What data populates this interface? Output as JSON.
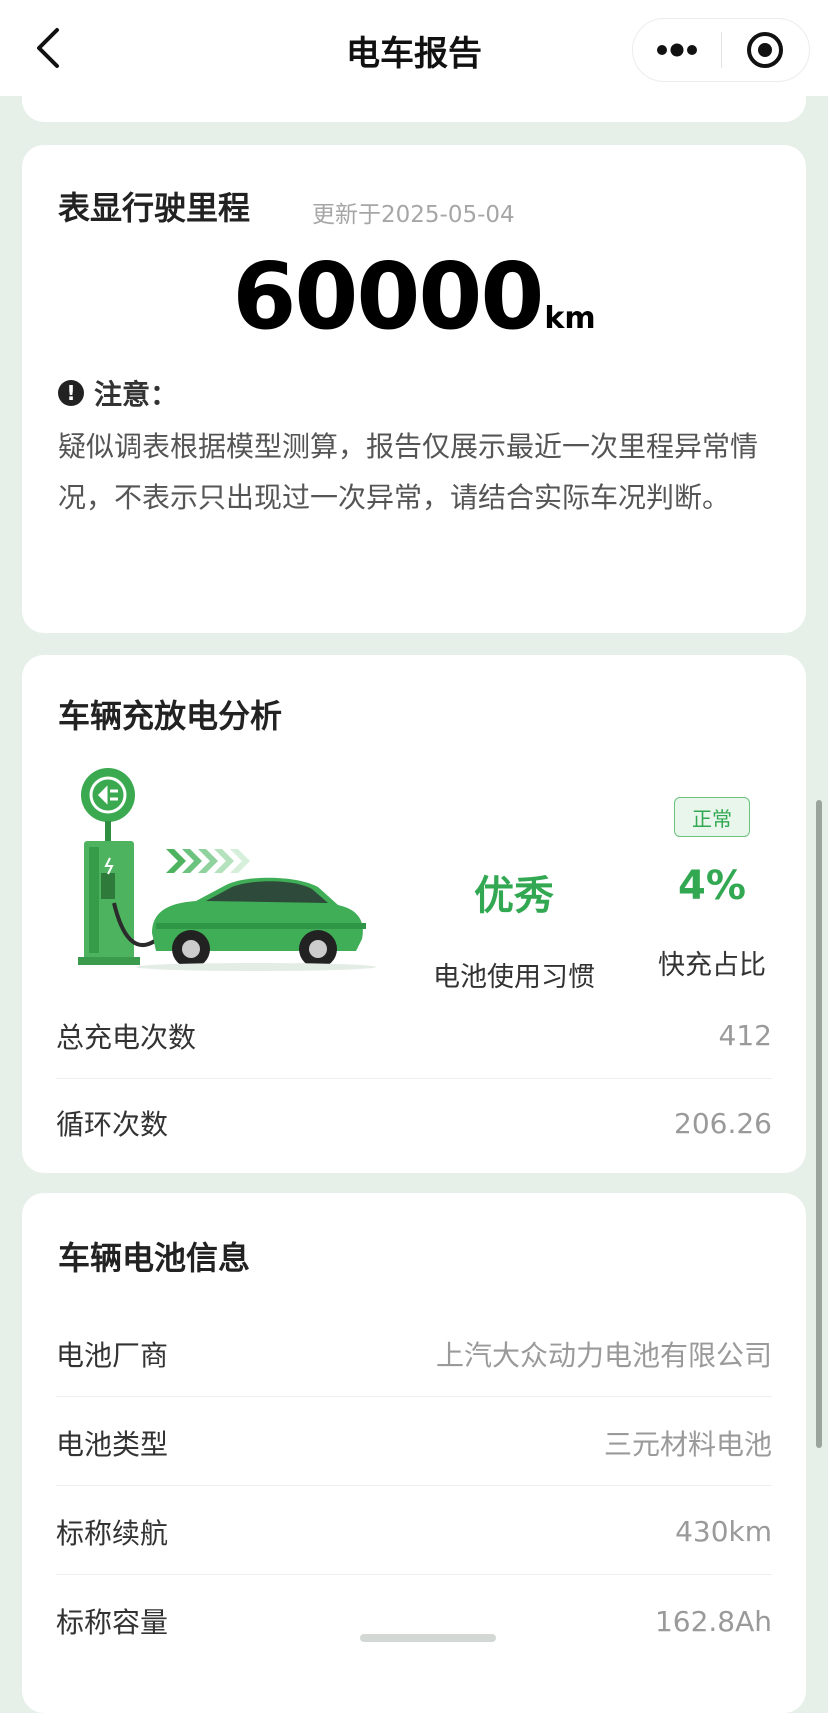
{
  "navbar": {
    "title": "电车报告"
  },
  "mileage_card": {
    "title": "表显行驶里程",
    "updated": "更新于2025-05-04",
    "value": "60000",
    "unit": "km",
    "notice_title": "注意：",
    "notice_icon": "!",
    "notice_text": "疑似调表根据模型测算，报告仅展示最近一次里程异常情况，不表示只出现过一次异常，请结合实际车况判断。"
  },
  "charge_card": {
    "title": "车辆充放电分析",
    "habit_value": "优秀",
    "habit_label": "电池使用习惯",
    "fast_charge_badge": "正常",
    "fast_charge_value": "4%",
    "fast_charge_label": "快充占比",
    "rows": [
      {
        "label": "总充电次数",
        "value": "412"
      },
      {
        "label": "循环次数",
        "value": "206.26"
      }
    ]
  },
  "battery_card": {
    "title": "车辆电池信息",
    "rows": [
      {
        "label": "电池厂商",
        "value": "上汽大众动力电池有限公司"
      },
      {
        "label": "电池类型",
        "value": "三元材料电池"
      },
      {
        "label": "标称续航",
        "value": "430km"
      },
      {
        "label": "标称容量",
        "value": "162.8Ah"
      }
    ]
  },
  "colors": {
    "accent_green": "#33a852",
    "badge_border": "#6cc27f",
    "page_background": "#e6f0e8"
  },
  "icons": {
    "back": "chevron-left-icon",
    "more": "more-dots-icon",
    "close": "target-circle-icon",
    "notice": "exclamation-circle-icon",
    "illustration": "ev-charging-illustration"
  }
}
